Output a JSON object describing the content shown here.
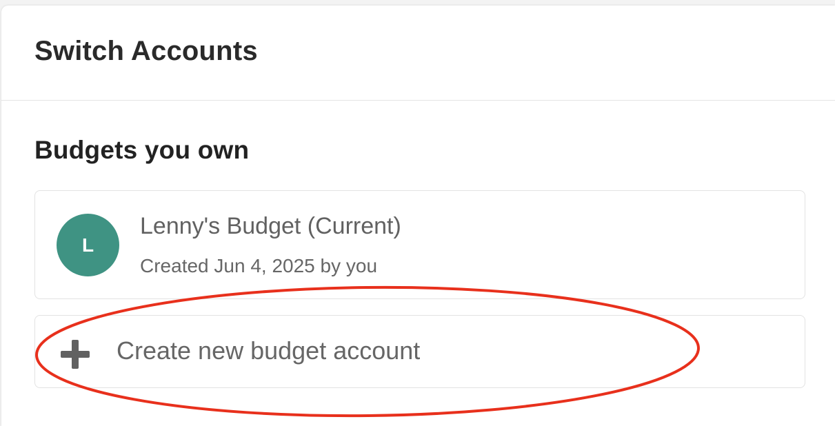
{
  "header": {
    "title": "Switch Accounts"
  },
  "section": {
    "title": "Budgets you own"
  },
  "accounts": [
    {
      "avatar_letter": "L",
      "avatar_color": "#3f9383",
      "name": "Lenny's Budget (Current)",
      "meta": "Created Jun 4, 2025 by you"
    }
  ],
  "create": {
    "label": "Create new budget account",
    "icon": "plus-icon"
  },
  "annotation": {
    "color": "#e8301c",
    "shape": "ellipse"
  }
}
